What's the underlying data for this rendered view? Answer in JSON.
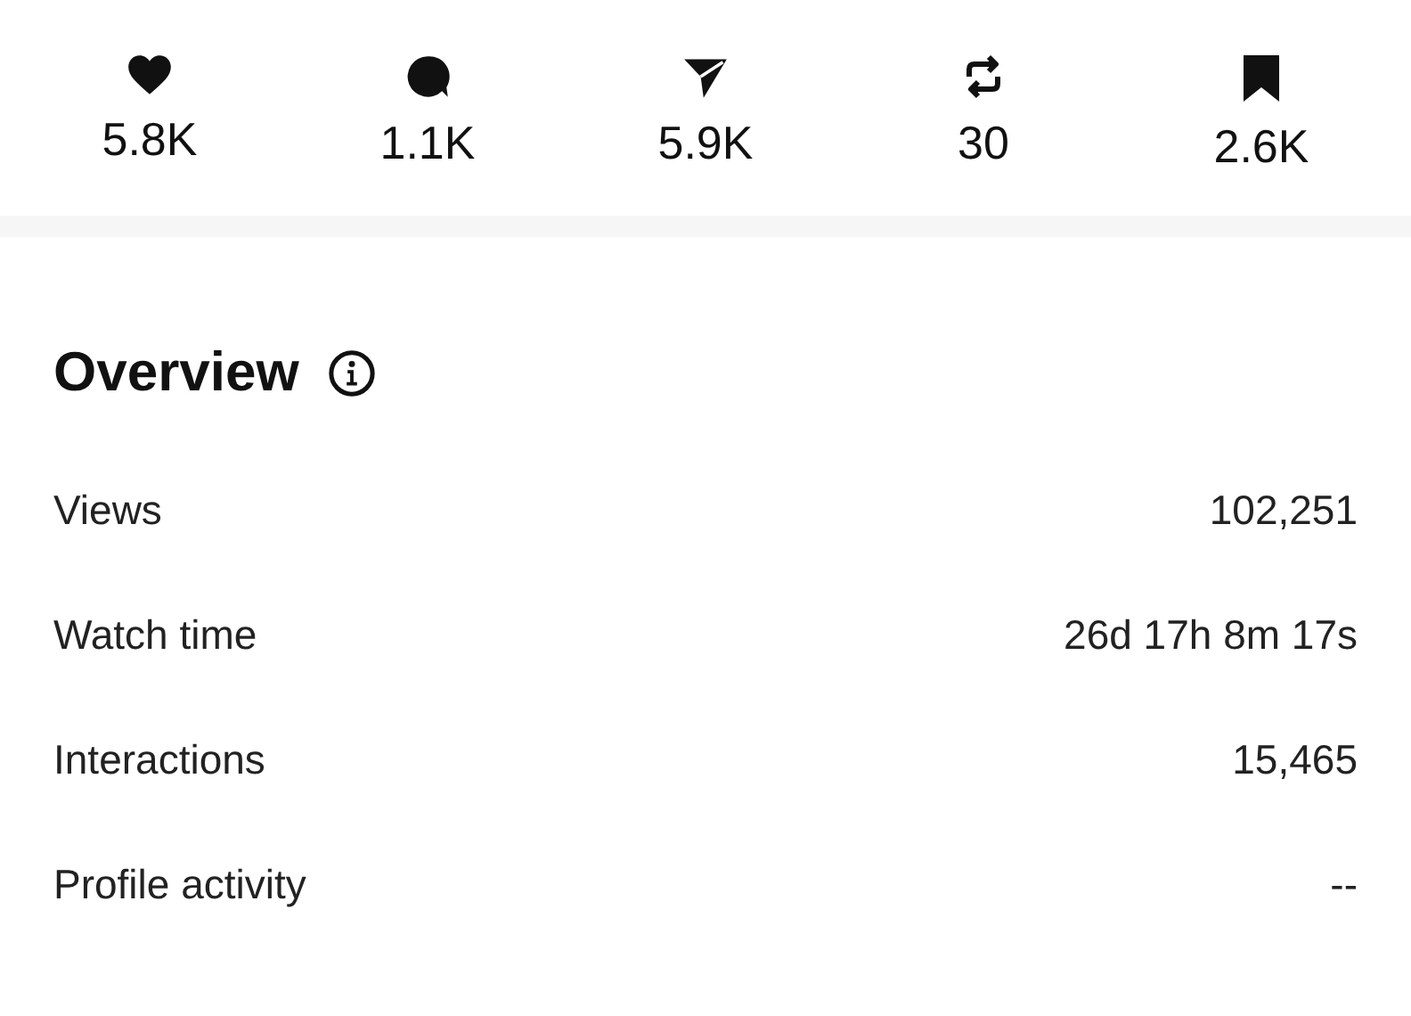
{
  "stats": [
    {
      "kind": "like",
      "count": "5.8K"
    },
    {
      "kind": "comment",
      "count": "1.1K"
    },
    {
      "kind": "share",
      "count": "5.9K"
    },
    {
      "kind": "repost",
      "count": "30"
    },
    {
      "kind": "save",
      "count": "2.6K"
    }
  ],
  "overview": {
    "title": "Overview",
    "rows": [
      {
        "label": "Views",
        "value": "102,251"
      },
      {
        "label": "Watch time",
        "value": "26d 17h 8m 17s"
      },
      {
        "label": "Interactions",
        "value": "15,465"
      },
      {
        "label": "Profile activity",
        "value": "--"
      }
    ]
  }
}
